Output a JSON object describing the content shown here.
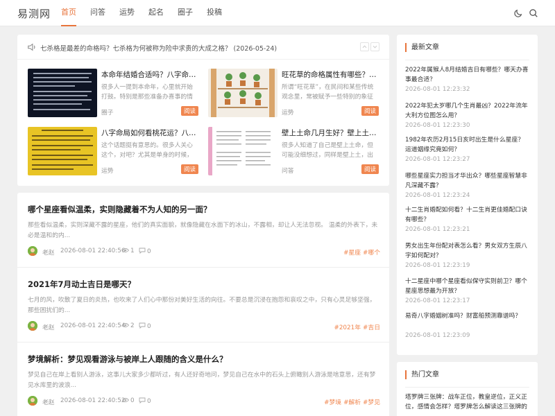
{
  "header": {
    "logo": "易测网",
    "nav": [
      "首页",
      "问答",
      "运势",
      "起名",
      "圈子",
      "投稿"
    ]
  },
  "notice": {
    "text": "七杀格是最差的命格吗？七杀格为何被称为险中求贵的大成之格？ (2026-05-24)"
  },
  "featured": [
    {
      "title": "本命年结婚合适吗？八字命理中的婚期选择",
      "desc": "很多人一提到本命年，心里就开始打鼓。特别是那些准备办喜事的情侣……",
      "category": "圈子",
      "read": "阅读"
    },
    {
      "title": "旺花草的命格属性有哪些？哪些人适合",
      "desc": "所谓“旺花草”，在民间和某些传统观念里，常被赋予一些特别的象征意义……",
      "category": "运势",
      "read": "阅读"
    },
    {
      "title": "八字命局如何看桃花运？八字中的桃花星",
      "desc": "这个话题挺有意思的。很多人关心这个，对吧？尤其是单身的时候，或……",
      "category": "运势",
      "read": "阅读"
    },
    {
      "title": "壁上土命几月生好？壁上土命的人性格",
      "desc": "很多人知道了自己是壁上土命，但可能没细想过，同样是壁上土，出生……",
      "category": "问答",
      "read": "阅读"
    }
  ],
  "posts": [
    {
      "title": "哪个星座看似温柔，实则隐藏着不为人知的另一面？",
      "excerpt": "那些看似温柔，实则深藏不露的星座，他们的真实面貌，就像隐藏在水面下的冰山，不露相，却让人无法忽视。 温柔的外表下，未必是温和的内...",
      "author": "老赵",
      "date": "2026-08-01 22:40:56",
      "views": "1",
      "comments": "0",
      "tags": [
        "#星座",
        "#哪个"
      ]
    },
    {
      "title": "2021年7月动土吉日是哪天？",
      "excerpt": "七月的风，吹散了夏日的炎热，也吹来了人们心中那份对美好生活的向往。不要总是沉浸在抱怨和哀叹之中，只有心灵足够坚强，那些困扰们的...",
      "author": "老赵",
      "date": "2026-08-01 22:40:54",
      "views": "2",
      "comments": "0",
      "tags": [
        "#2021年",
        "#吉日"
      ]
    },
    {
      "title": "梦境解析：梦见观看游泳与被岸上人跟随的含义是什么？",
      "excerpt": "梦见自己在岸上看别人游泳，这事儿大家多少都听过，有人还好奇地问，梦见自己在水中的石头上俯瞰别人游泳是啥意思，还有梦见水库里的波浪...",
      "author": "老赵",
      "date": "2026-08-01 22:40:52",
      "views": "0",
      "comments": "0",
      "tags": [
        "#梦境",
        "#解析",
        "#梦见"
      ]
    }
  ],
  "sidebar": {
    "latest_title": "最新文章",
    "latest": [
      {
        "title": "2022年属猴人8月结婚吉日有哪些？哪天办喜事最合适？",
        "date": "2026-08-01 12:23:32"
      },
      {
        "title": "2022年犯太岁哪几个生肖最凶？2022年流年大利方位图怎么用？",
        "date": "2026-08-01 12:23:30"
      },
      {
        "title": "1982年农历2月15日亥时出生是什么星座？运道姻缘究竟如何？",
        "date": "2026-08-01 12:23:27"
      },
      {
        "title": "哪些星座实力担当才华出众？哪些星座智慧非凡深藏不露？",
        "date": "2026-08-01 12:23:24"
      },
      {
        "title": "十二生肖婚配如何看？十二生肖更佳婚配口诀有哪些？",
        "date": "2026-08-01 12:23:21"
      },
      {
        "title": "男女出生年份配对表怎么看？男女双方生辰八字如何配对？",
        "date": "2026-08-01 12:23:19"
      },
      {
        "title": "十二星座中哪个星座看似保守实则前卫？哪个星座思想最为开放？",
        "date": "2026-08-01 12:23:17"
      },
      {
        "title": "易奇八字婚姻树准吗？财富船预测靠谱吗？",
        "date": "2026-08-01 12:23:09"
      }
    ],
    "hot_title": "热门文章",
    "hot": [
      {
        "title": "塔罗牌三张牌：战车正位，教皇逆位，正义正位，感情会怎样？塔罗牌怎么解读这三张牌的"
      }
    ]
  }
}
